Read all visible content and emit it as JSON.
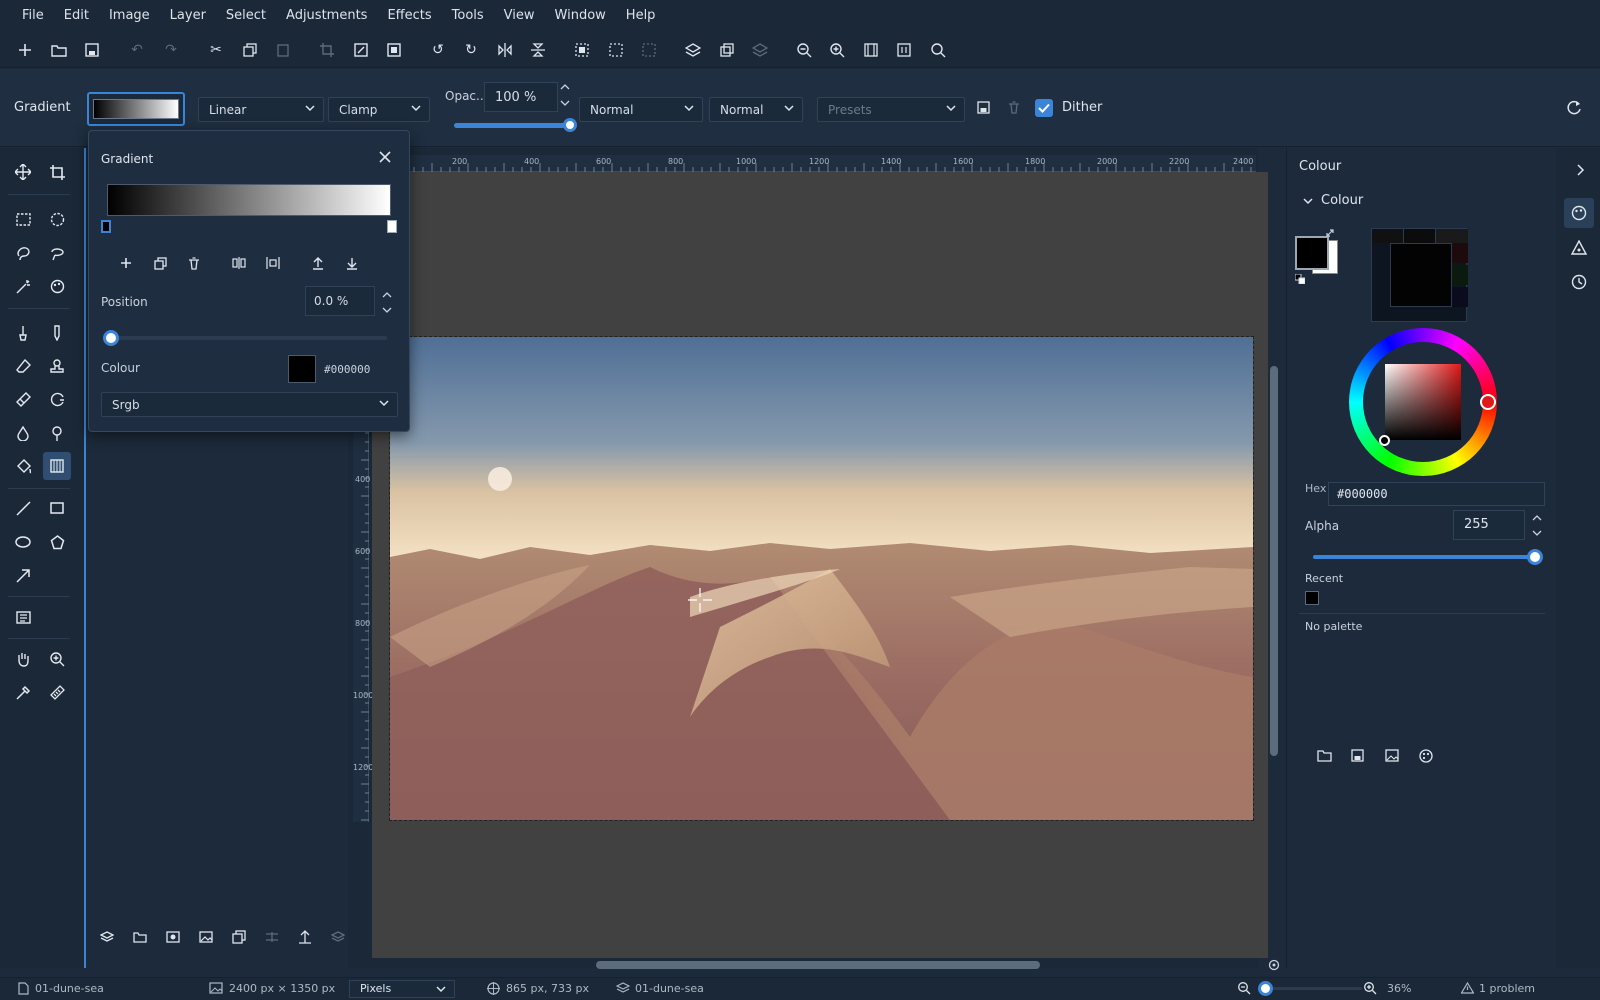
{
  "menu": [
    "File",
    "Edit",
    "Image",
    "Layer",
    "Select",
    "Adjustments",
    "Effects",
    "Tools",
    "View",
    "Window",
    "Help"
  ],
  "options": {
    "tool_label": "Gradient",
    "gradient_type": "Linear",
    "repeat_mode": "Clamp",
    "opacity_label": "Opac...",
    "opacity_value": "100 %",
    "opacity_fraction": 1.0,
    "blend_mode_1": "Normal",
    "blend_mode_2": "Normal",
    "presets_placeholder": "Presets",
    "dither_label": "Dither",
    "dither_checked": true
  },
  "gradient_popup": {
    "title": "Gradient",
    "position_label": "Position",
    "position_value": "0.0 %",
    "position_fraction": 0.0,
    "colour_label": "Colour",
    "colour_hex": "#000000",
    "colour_space": "Srgb"
  },
  "ruler": {
    "h_ticks": [
      "200",
      "400",
      "600",
      "800",
      "1000",
      "1200",
      "1400",
      "1600",
      "1800",
      "2000",
      "2200",
      "2400"
    ],
    "v_ticks": [
      "400",
      "600",
      "800",
      "1000",
      "1200"
    ]
  },
  "right_panel": {
    "header": "Colour",
    "section": "Colour",
    "hex_label": "Hex",
    "hex_value": "#000000",
    "alpha_label": "Alpha",
    "alpha_value": "255",
    "alpha_fraction": 1.0,
    "recent_label": "Recent",
    "palette_label": "No palette"
  },
  "status": {
    "document": "01-dune-sea",
    "image_size": "2400 px × 1350 px",
    "units": "Pixels",
    "cursor_pos": "865 px, 733 px",
    "layer": "01-dune-sea",
    "zoom": "36%",
    "problems": "1 problem"
  },
  "colors": {
    "accent": "#3a85d8",
    "primary": "#000000",
    "secondary": "#ffffff"
  }
}
